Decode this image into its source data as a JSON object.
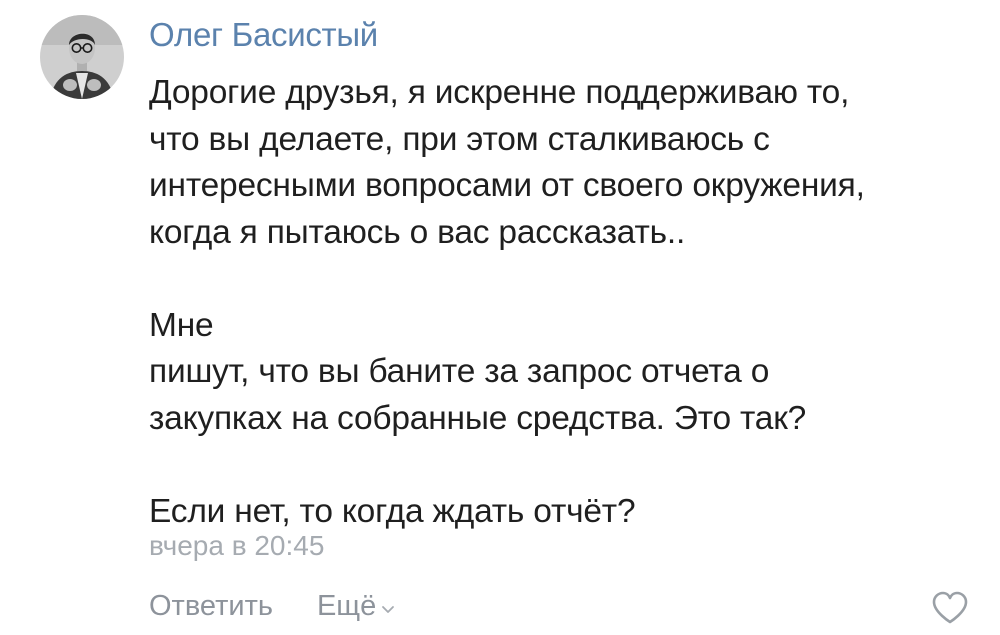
{
  "comment": {
    "author": "Олег Басистый",
    "lines": [
      "Дорогие друзья, я искренне поддерживаю то,",
      "что вы делаете, при этом сталкиваюсь с",
      "интересными вопросами от своего окружения,",
      "когда я пытаюсь о вас рассказать..",
      "",
      "Мне",
      "пишут, что вы баните за запрос отчета о",
      "закупках на собранные средства. Это так?",
      "",
      "Если нет, то когда ждать отчёт?"
    ],
    "timestamp": "вчера в 20:45",
    "actions": {
      "reply_label": "Ответить",
      "more_label": "Ещё"
    },
    "icons": {
      "avatar": "avatar",
      "more": "chevron-down-icon",
      "like": "heart-icon"
    }
  },
  "colors": {
    "author_link": "#5b82ad",
    "text": "#1f1f1f",
    "meta": "#a6abb1",
    "action": "#8d939b"
  }
}
